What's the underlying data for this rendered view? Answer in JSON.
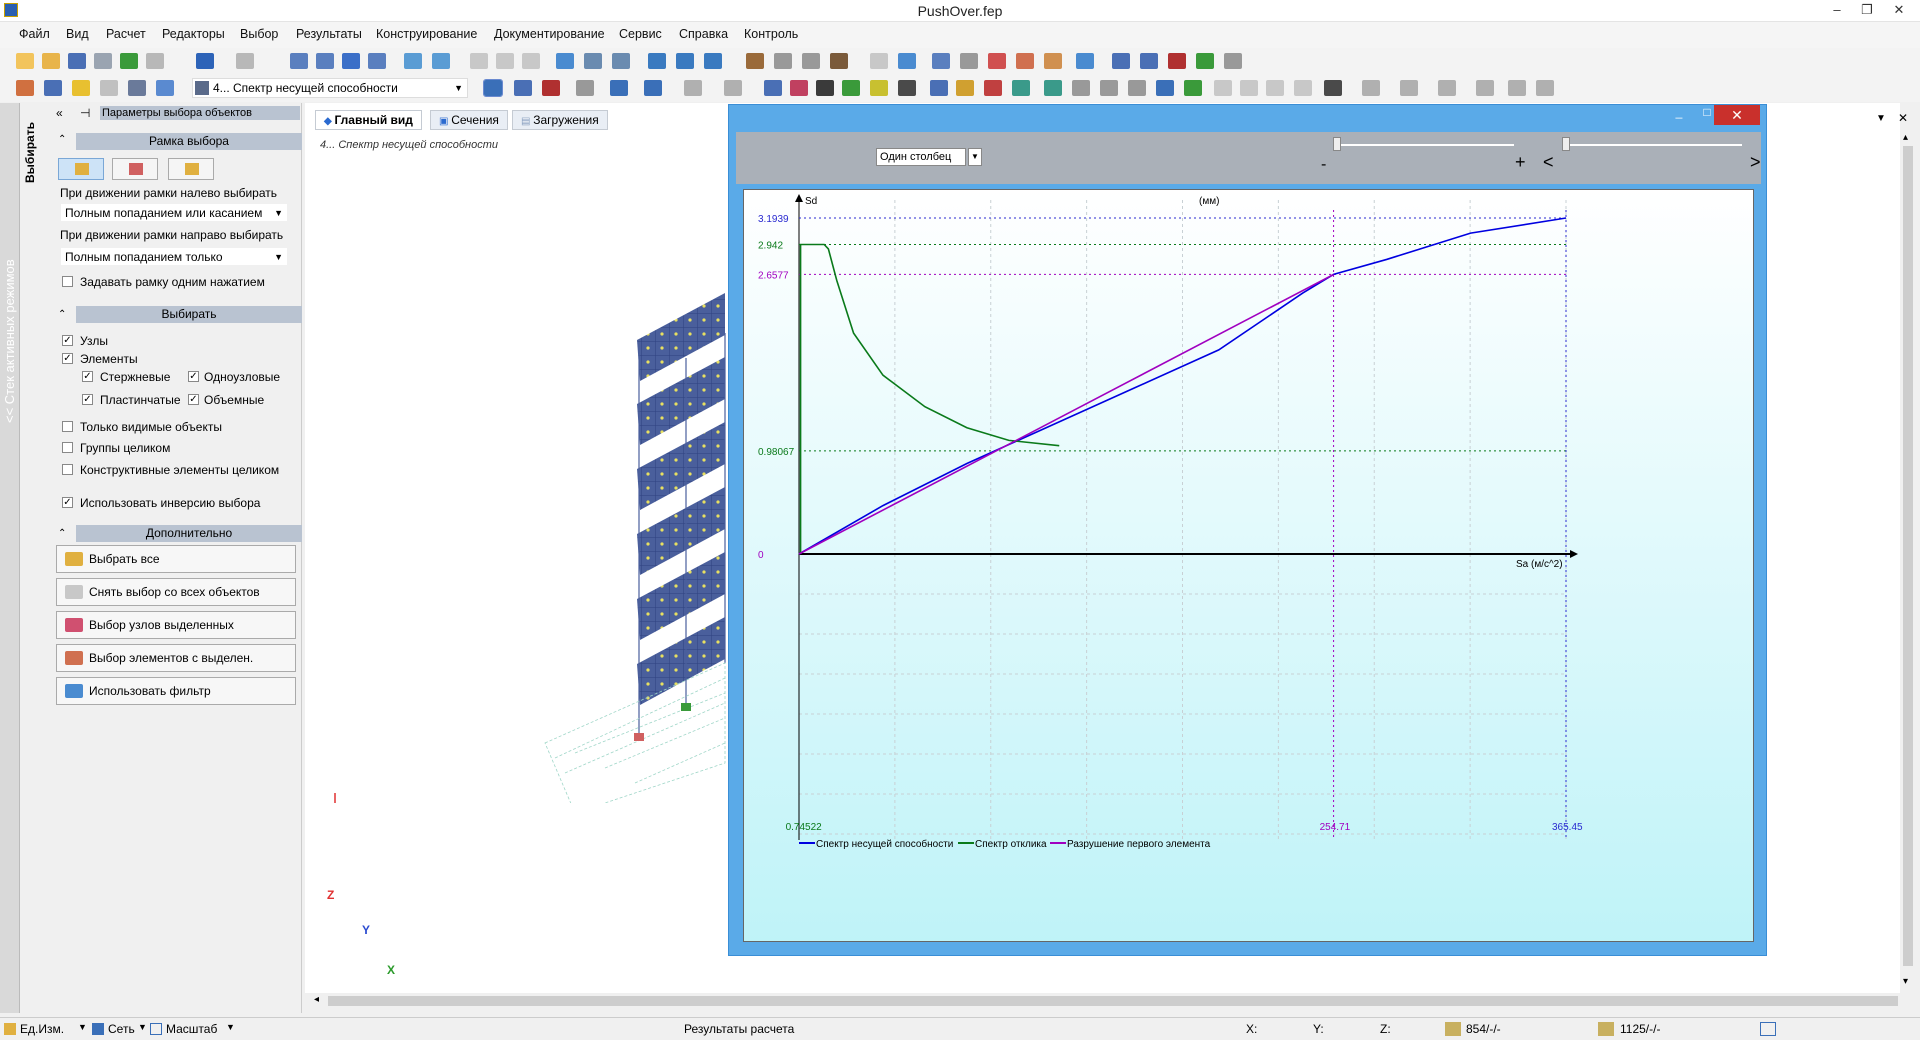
{
  "window": {
    "title": "PushOver.fep",
    "minimize": "–",
    "maximize": "❐",
    "close": "✕"
  },
  "menu": [
    "Файл",
    "Вид",
    "Расчет",
    "Редакторы",
    "Выбор",
    "Результаты",
    "Конструирование",
    "Документирование",
    "Сервис",
    "Справка",
    "Контроль"
  ],
  "toolbar": {
    "load_case_select": "4... Спектр несущей способности"
  },
  "vertical_tabs": {
    "outer": "<< Стек активных режимов",
    "inner": "Выбирать"
  },
  "side_panel": {
    "header": "Параметры выбора объектов",
    "frame_section": "Рамка выбора",
    "left_move_label": "При движении рамки налево выбирать",
    "left_move_value": "Полным попаданием или касанием",
    "right_move_label": "При движении рамки направо выбирать",
    "right_move_value": "Полным попаданием только",
    "single_click": "Задавать рамку одним нажатием",
    "select_section": "Выбирать",
    "nodes": "Узлы",
    "elements": "Элементы",
    "rods": "Стержневые",
    "single_node": "Одноузловые",
    "plates": "Пластинчатые",
    "volumes": "Объемные",
    "visible_only": "Только видимые объекты",
    "groups_whole": "Группы целиком",
    "constructive_whole": "Конструктивные элементы целиком",
    "use_inversion": "Использовать инверсию выбора",
    "extra_section": "Дополнительно",
    "buttons": [
      "Выбрать все",
      "Снять выбор со всех объектов",
      "Выбор узлов выделенных элементов",
      "Выбор элементов с выделен. узлами",
      "Использовать фильтр"
    ]
  },
  "tabs": [
    "Главный вид",
    "Сечения",
    "Загружения"
  ],
  "canvas_note": "4... Спектр несущей способности",
  "axes_labels": {
    "z": "Z",
    "y": "Y",
    "x": "X"
  },
  "pushover": {
    "combo": "Один столбец",
    "minus": "-",
    "plus": "+",
    "prev": "<",
    "next": ">"
  },
  "chart_data": {
    "type": "line",
    "ylabel": "Sd",
    "unit": "(мм)",
    "xlabel": "Sa (м/с^2)",
    "xlim": [
      0,
      365.45
    ],
    "ylim": [
      0,
      3.1939
    ],
    "y_ticks": [
      "3.1939",
      "2.942",
      "2.6577",
      "0.98067",
      "0"
    ],
    "x_ticks": [
      "0.74522",
      "254.71",
      "365.45"
    ],
    "series": [
      {
        "name": "Спектр несущей способности",
        "color": "#0000e0",
        "x": [
          0,
          40,
          80,
          120,
          160,
          200,
          240,
          254.71,
          280,
          320,
          365.45
        ],
        "y": [
          0,
          0.46,
          0.86,
          1.22,
          1.58,
          1.94,
          2.48,
          2.6577,
          2.8,
          3.05,
          3.1939
        ]
      },
      {
        "name": "Спектр отклика",
        "color": "#0a7a1a",
        "x": [
          0.74522,
          0.74522,
          12,
          14,
          18,
          26,
          40,
          60,
          80,
          100,
          124
        ],
        "y": [
          0,
          2.942,
          2.942,
          2.9,
          2.6,
          2.1,
          1.7,
          1.4,
          1.2,
          1.08,
          1.03
        ]
      },
      {
        "name": "Разрушение первого элемента",
        "color": "#a000c0",
        "x": [
          0,
          254.71
        ],
        "y": [
          0,
          2.6577
        ]
      }
    ]
  },
  "status": {
    "units": "Ед.Изм.",
    "grid": "Сеть",
    "scale": "Масштаб",
    "center": "Результаты расчета",
    "x": "X:",
    "y": "Y:",
    "z": "Z:",
    "a": "854/-/-",
    "b": "1125/-/-"
  }
}
